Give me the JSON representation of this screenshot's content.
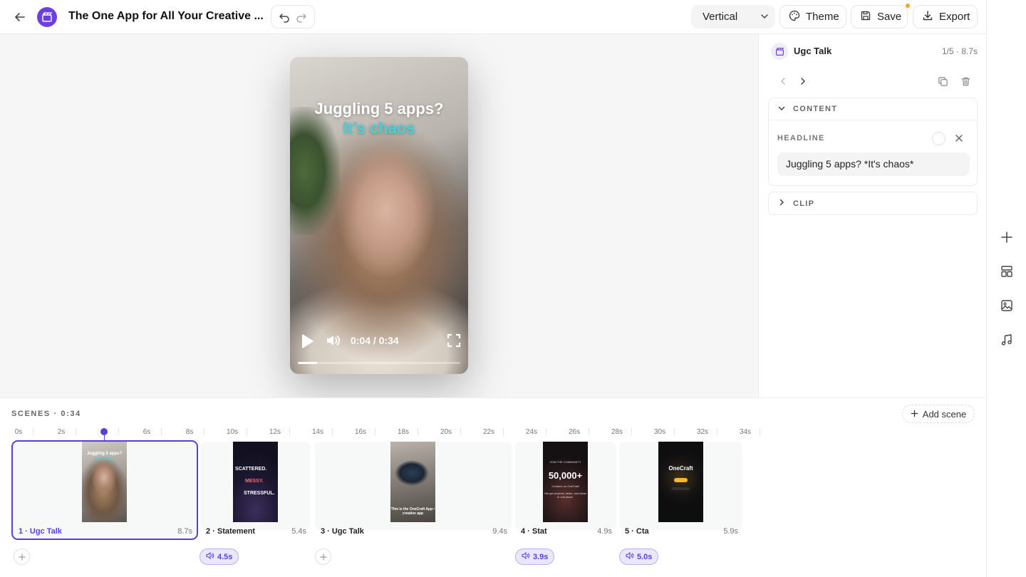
{
  "header": {
    "title": "The One App for All Your Creative ...",
    "format": {
      "selected": "Vertical"
    },
    "theme_label": "Theme",
    "save_label": "Save",
    "export_label": "Export"
  },
  "preview": {
    "headline_line1": "Juggling 5 apps?",
    "headline_line2": "It’s chaos",
    "time": "0:04 / 0:34",
    "progress": 0.118
  },
  "inspector": {
    "scene_name": "Ugc Talk",
    "scene_meta": "1/5 · 8.7s",
    "content_section": "CONTENT",
    "headline_label": "HEADLINE",
    "headline_value": "Juggling 5 apps? *It's chaos*",
    "clip_section": "CLIP"
  },
  "timeline": {
    "label": "SCENES · 0:34",
    "add_scene": "Add scene",
    "ticks": [
      "0s",
      "2s",
      "4s",
      "6s",
      "8s",
      "10s",
      "12s",
      "14s",
      "16s",
      "18s",
      "20s",
      "22s",
      "24s",
      "26s",
      "28s",
      "30s",
      "32s",
      "34s"
    ],
    "playhead_time_s": 4,
    "scenes": [
      {
        "label": "1 · Ugc Talk",
        "duration": "8.7s",
        "selected": true,
        "thumb_text": [
          "Juggling 5 apps?",
          "It's chaos"
        ]
      },
      {
        "label": "2 · Statement",
        "duration": "5.4s",
        "thumb_text": [
          "SCATTERED.",
          "MESSY.",
          "STRESSFUL."
        ],
        "audio": "4.5s"
      },
      {
        "label": "3 · Ugc Talk",
        "duration": "9.4s",
        "thumb_text": [
          "This is the OneCraft App • creative app"
        ]
      },
      {
        "label": "4 · Stat",
        "duration": "4.9s",
        "thumb_text": [
          "JOIN THE COMMUNITY",
          "50,000+",
          "Creators on OneCraft",
          "We get projects, tasks, and ideas in one place."
        ],
        "audio": "3.9s"
      },
      {
        "label": "5 · Cta",
        "duration": "5.9s",
        "thumb_text": [
          "OneCraft",
          "Get Free",
          "onecraft.app",
          "Download the app today"
        ],
        "audio": "5.0s"
      }
    ]
  },
  "colors": {
    "accent": "#5a3fd6",
    "caption_highlight": "#43d2dc",
    "save_indicator": "#f5a623"
  },
  "icons": [
    "back-arrow-icon",
    "clapperboard-icon",
    "undo-icon",
    "redo-icon",
    "chevron-down-icon",
    "palette-icon",
    "save-icon",
    "download-icon",
    "play-icon",
    "volume-icon",
    "fullscreen-icon",
    "chevron-left-icon",
    "chevron-right-icon",
    "duplicate-icon",
    "trash-icon",
    "close-icon",
    "plus-icon",
    "layout-icon",
    "image-icon",
    "music-icon",
    "speaker-icon"
  ]
}
